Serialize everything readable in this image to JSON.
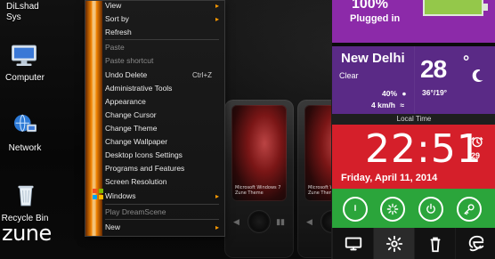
{
  "desktop": {
    "top_user_lines": [
      "DiLshad",
      "Sys"
    ],
    "icons": [
      {
        "label": "Computer",
        "icon": "computer-icon"
      },
      {
        "label": "Network",
        "icon": "network-icon"
      },
      {
        "label": "Recycle Bin",
        "icon": "recycle-bin-icon"
      }
    ],
    "brand": "zune"
  },
  "context_menu": {
    "items": [
      {
        "label": "View",
        "type": "submenu"
      },
      {
        "label": "Sort by",
        "type": "submenu"
      },
      {
        "label": "Refresh",
        "type": "item"
      },
      {
        "type": "separator"
      },
      {
        "label": "Paste",
        "type": "item",
        "disabled": true
      },
      {
        "label": "Paste shortcut",
        "type": "item",
        "disabled": true
      },
      {
        "label": "Undo Delete",
        "type": "item",
        "shortcut": "Ctrl+Z"
      },
      {
        "label": "Administrative Tools",
        "type": "item"
      },
      {
        "label": "Appearance",
        "type": "item"
      },
      {
        "label": "Change Cursor",
        "type": "item"
      },
      {
        "label": "Change Theme",
        "type": "item"
      },
      {
        "label": "Change Wallpaper",
        "type": "item"
      },
      {
        "label": "Desktop Icons Settings",
        "type": "item"
      },
      {
        "label": "Programs and Features",
        "type": "item"
      },
      {
        "label": "Screen Resolution",
        "type": "item"
      },
      {
        "label": "Windows",
        "type": "submenu"
      },
      {
        "type": "separator"
      },
      {
        "label": "Play DreamScene",
        "type": "item",
        "disabled": true
      },
      {
        "type": "separator"
      },
      {
        "label": "New",
        "type": "submenu"
      }
    ]
  },
  "live_panel": {
    "battery": {
      "percent": "100%",
      "status": "Plugged in"
    },
    "weather": {
      "city": "New Delhi",
      "condition": "Clear",
      "humidity": "40%",
      "wind": "4 km/h",
      "temperature": "28",
      "range": "36°/19°"
    },
    "clock": {
      "label": "Local Time",
      "time": "22:51",
      "alarm_day": "29",
      "date": "Friday, April 11, 2014"
    },
    "dock": [
      "display-icon",
      "settings-gear-icon",
      "recycle-bin-icon",
      "internet-explorer-icon"
    ]
  },
  "devices": {
    "screen_caption": "Microsoft Windows 7\nZune Theme"
  },
  "colors": {
    "battery_tile": "#8c2aa9",
    "weather_tile": "#5a2a86",
    "clock_tile": "#d51f2a",
    "power_tile": "#2ba53b",
    "menu_accent": "#ff8a00"
  }
}
